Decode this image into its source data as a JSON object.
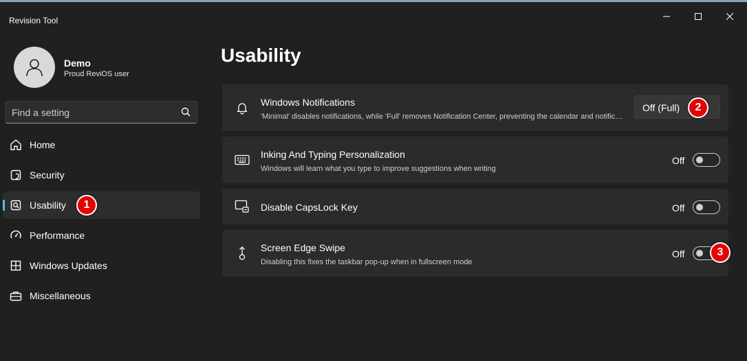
{
  "window": {
    "title": "Revision Tool",
    "controls": [
      "minimize-icon",
      "maximize-icon",
      "close-icon"
    ]
  },
  "profile": {
    "name": "Demo",
    "subtitle": "Proud ReviOS user",
    "avatar_icon": "person-icon"
  },
  "search": {
    "placeholder": "Find a setting",
    "value": "",
    "icon": "search-icon"
  },
  "sidebar": {
    "items": [
      {
        "label": "Home",
        "icon": "home-icon",
        "active": false
      },
      {
        "label": "Security",
        "icon": "shield-icon",
        "active": false
      },
      {
        "label": "Usability",
        "icon": "usability-icon",
        "active": true
      },
      {
        "label": "Performance",
        "icon": "gauge-icon",
        "active": false
      },
      {
        "label": "Windows Updates",
        "icon": "windows-update-icon",
        "active": false
      },
      {
        "label": "Miscellaneous",
        "icon": "toolbox-icon",
        "active": false
      }
    ]
  },
  "main": {
    "title": "Usability",
    "settings": [
      {
        "title": "Windows Notifications",
        "description": "'Minimal' disables notifications, while 'Full' removes Notification Center, preventing the calendar and notifications from working.",
        "control": "dropdown",
        "value": "Off (Full)",
        "icon": "bell-icon"
      },
      {
        "title": "Inking And Typing Personalization",
        "description": "Windows will learn what you type to improve suggestions when writing",
        "control": "toggle",
        "state": "Off",
        "icon": "keyboard-icon"
      },
      {
        "title": "Disable CapsLock Key",
        "description": "",
        "control": "toggle",
        "state": "Off",
        "icon": "capslock-monitor-icon"
      },
      {
        "title": "Screen Edge Swipe",
        "description": "Disabling this fixes the taskbar pop-up when in fullscreen mode",
        "control": "toggle",
        "state": "Off",
        "icon": "swipe-up-icon"
      }
    ]
  },
  "annotations": [
    "1",
    "2",
    "3"
  ],
  "colors": {
    "background": "#202020",
    "card": "#2b2b2b",
    "accent": "#4cc2ff",
    "badge": "#e60000"
  }
}
